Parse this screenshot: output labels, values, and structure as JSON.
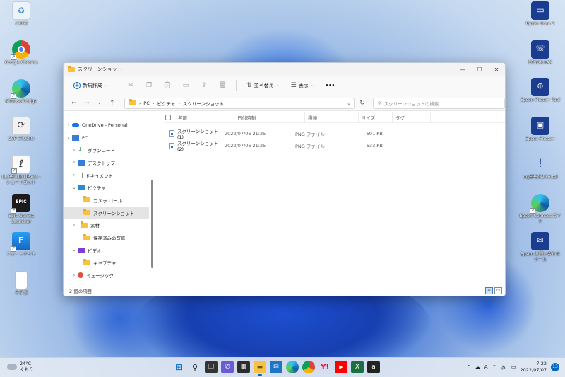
{
  "desktop": {
    "left_icons": [
      {
        "label": "ごみ箱"
      },
      {
        "label": "Google Chrome"
      },
      {
        "label": "Microsoft Edge"
      },
      {
        "label": "CSP STUDIO"
      },
      {
        "label": "CLIPSTUDIOPaint - ショートカット"
      },
      {
        "label": "Epic Games Launcher"
      },
      {
        "label": "フォートナイト"
      },
      {
        "label": "ネタ帳"
      }
    ],
    "right_icons": [
      {
        "label": "Epson Scan 2"
      },
      {
        "label": "EPSON FAX"
      },
      {
        "label": "Epson Photo+ Tool"
      },
      {
        "label": "Epson Photo+"
      },
      {
        "label": "myEPSON Portal"
      },
      {
        "label": "Epson Connect ガイド"
      },
      {
        "label": "Epson お問い合わせツール"
      }
    ]
  },
  "window": {
    "title": "スクリーンショット",
    "controls": {
      "minimize": "—",
      "maximize": "☐",
      "close": "✕"
    },
    "toolbar": {
      "new_label": "新規作成",
      "sort_label": "並べ替え",
      "view_label": "表示",
      "more_label": "•••"
    },
    "address": {
      "crumbs": [
        "PC",
        "ピクチャ",
        "スクリーンショット"
      ],
      "separator": "›"
    },
    "search_placeholder": "スクリーンショットの検索",
    "sidebar": [
      {
        "label": "OneDrive - Personal",
        "arrow": "›"
      },
      {
        "label": "PC",
        "arrow": "⌄"
      },
      {
        "label": "ダウンロード",
        "arrow": "›"
      },
      {
        "label": "デスクトップ",
        "arrow": "›"
      },
      {
        "label": "ドキュメント",
        "arrow": "›"
      },
      {
        "label": "ピクチャ",
        "arrow": "⌄"
      },
      {
        "label": "カメラ ロール",
        "arrow": ""
      },
      {
        "label": "スクリーンショット",
        "arrow": ""
      },
      {
        "label": "素材",
        "arrow": "›"
      },
      {
        "label": "保存済みの写真",
        "arrow": ""
      },
      {
        "label": "ビデオ",
        "arrow": "⌄"
      },
      {
        "label": "キャプチャ",
        "arrow": ""
      },
      {
        "label": "ミュージック",
        "arrow": "›"
      }
    ],
    "columns": [
      "名前",
      "日付時刻",
      "種類",
      "サイズ",
      "タグ"
    ],
    "files": [
      {
        "name": "スクリーンショット (1)",
        "date": "2022/07/06 21:25",
        "type": "PNG ファイル",
        "size": "691 KB"
      },
      {
        "name": "スクリーンショット (2)",
        "date": "2022/07/06 21:25",
        "type": "PNG ファイル",
        "size": "633 KB"
      }
    ],
    "status": "2 個の項目"
  },
  "taskbar": {
    "weather_temp": "24°C",
    "weather_desc": "くもり",
    "time": "7:22",
    "date": "2022/07/07",
    "notifications": "13",
    "ime": "A"
  },
  "colors": {
    "accent": "#0067c0",
    "folder": "#f5c242"
  }
}
